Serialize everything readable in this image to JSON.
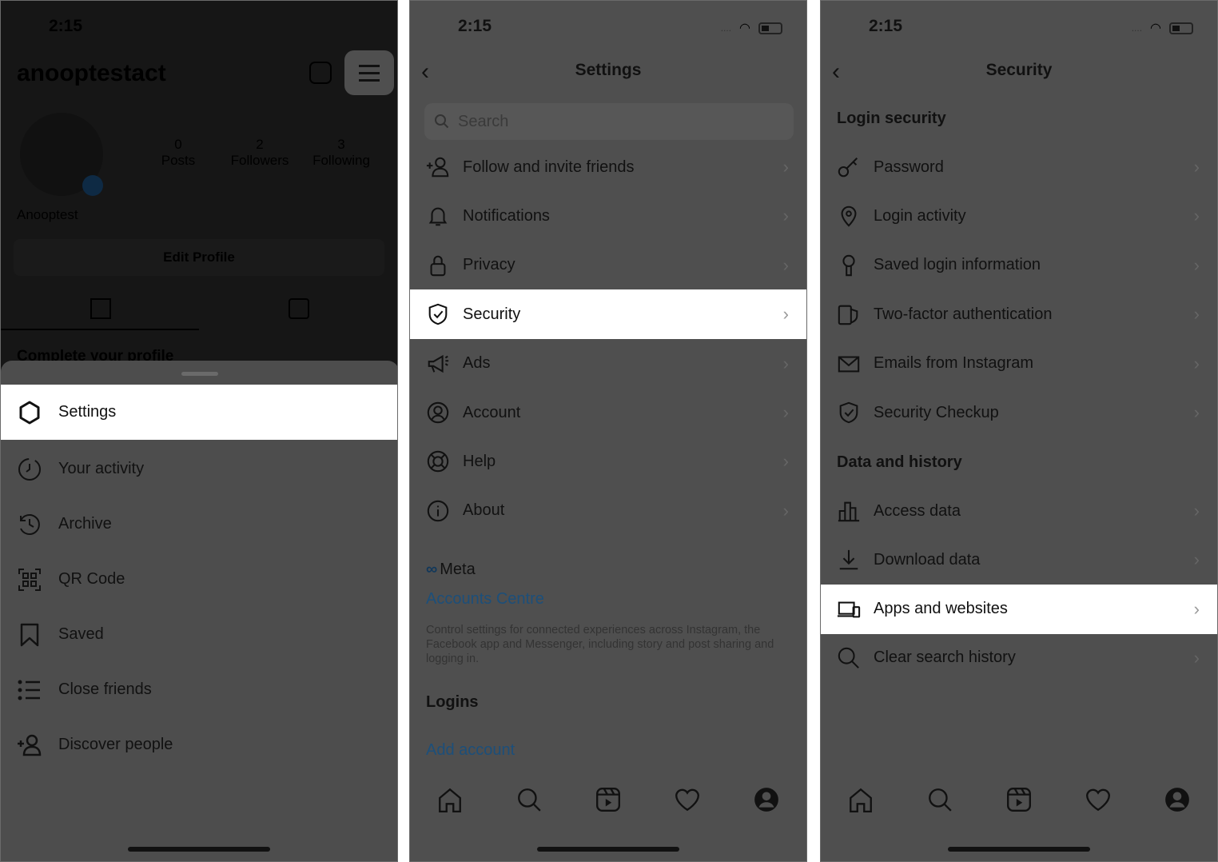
{
  "status": {
    "time": "2:15"
  },
  "profile": {
    "username": "anooptestact",
    "display_name": "Anooptest",
    "posts_count": "0",
    "posts_label": "Posts",
    "followers_count": "2",
    "followers_label": "Followers",
    "following_count": "3",
    "following_label": "Following",
    "edit_profile": "Edit Profile",
    "complete_profile": "Complete your profile"
  },
  "menu": {
    "items": [
      {
        "label": "Settings",
        "icon": "settings-icon",
        "highlighted": true
      },
      {
        "label": "Your activity",
        "icon": "activity-icon"
      },
      {
        "label": "Archive",
        "icon": "archive-icon"
      },
      {
        "label": "QR Code",
        "icon": "qr-code-icon"
      },
      {
        "label": "Saved",
        "icon": "bookmark-icon"
      },
      {
        "label": "Close friends",
        "icon": "list-icon"
      },
      {
        "label": "Discover people",
        "icon": "add-person-icon"
      }
    ]
  },
  "settings": {
    "title": "Settings",
    "search_placeholder": "Search",
    "items": [
      {
        "label": "Follow and invite friends",
        "icon": "add-person-icon"
      },
      {
        "label": "Notifications",
        "icon": "bell-icon"
      },
      {
        "label": "Privacy",
        "icon": "lock-icon"
      },
      {
        "label": "Security",
        "icon": "shield-icon",
        "highlighted": true
      },
      {
        "label": "Ads",
        "icon": "megaphone-icon"
      },
      {
        "label": "Account",
        "icon": "account-icon"
      },
      {
        "label": "Help",
        "icon": "lifebuoy-icon"
      },
      {
        "label": "About",
        "icon": "info-icon"
      }
    ],
    "meta_label": "Meta",
    "accounts_centre": "Accounts Centre",
    "meta_description": "Control settings for connected experiences across Instagram, the Facebook app and Messenger, including story and post sharing and logging in.",
    "logins_header": "Logins",
    "add_account": "Add account"
  },
  "security": {
    "title": "Security",
    "login_header": "Login security",
    "login_items": [
      {
        "label": "Password",
        "icon": "key-icon"
      },
      {
        "label": "Login activity",
        "icon": "location-pin-icon"
      },
      {
        "label": "Saved login information",
        "icon": "keyhole-icon"
      },
      {
        "label": "Two-factor authentication",
        "icon": "two-factor-icon"
      },
      {
        "label": "Emails from Instagram",
        "icon": "mail-icon"
      },
      {
        "label": "Security Checkup",
        "icon": "shield-check-icon"
      }
    ],
    "data_header": "Data and history",
    "data_items": [
      {
        "label": "Access data",
        "icon": "bar-chart-icon"
      },
      {
        "label": "Download data",
        "icon": "download-icon"
      },
      {
        "label": "Apps and websites",
        "icon": "devices-icon",
        "highlighted": true
      },
      {
        "label": "Clear search history",
        "icon": "search-icon"
      }
    ]
  },
  "colors": {
    "link": "#1c4f7a",
    "highlight": "#ffffff",
    "panel": "#4f4f4f",
    "overlay_top": "#161616"
  }
}
